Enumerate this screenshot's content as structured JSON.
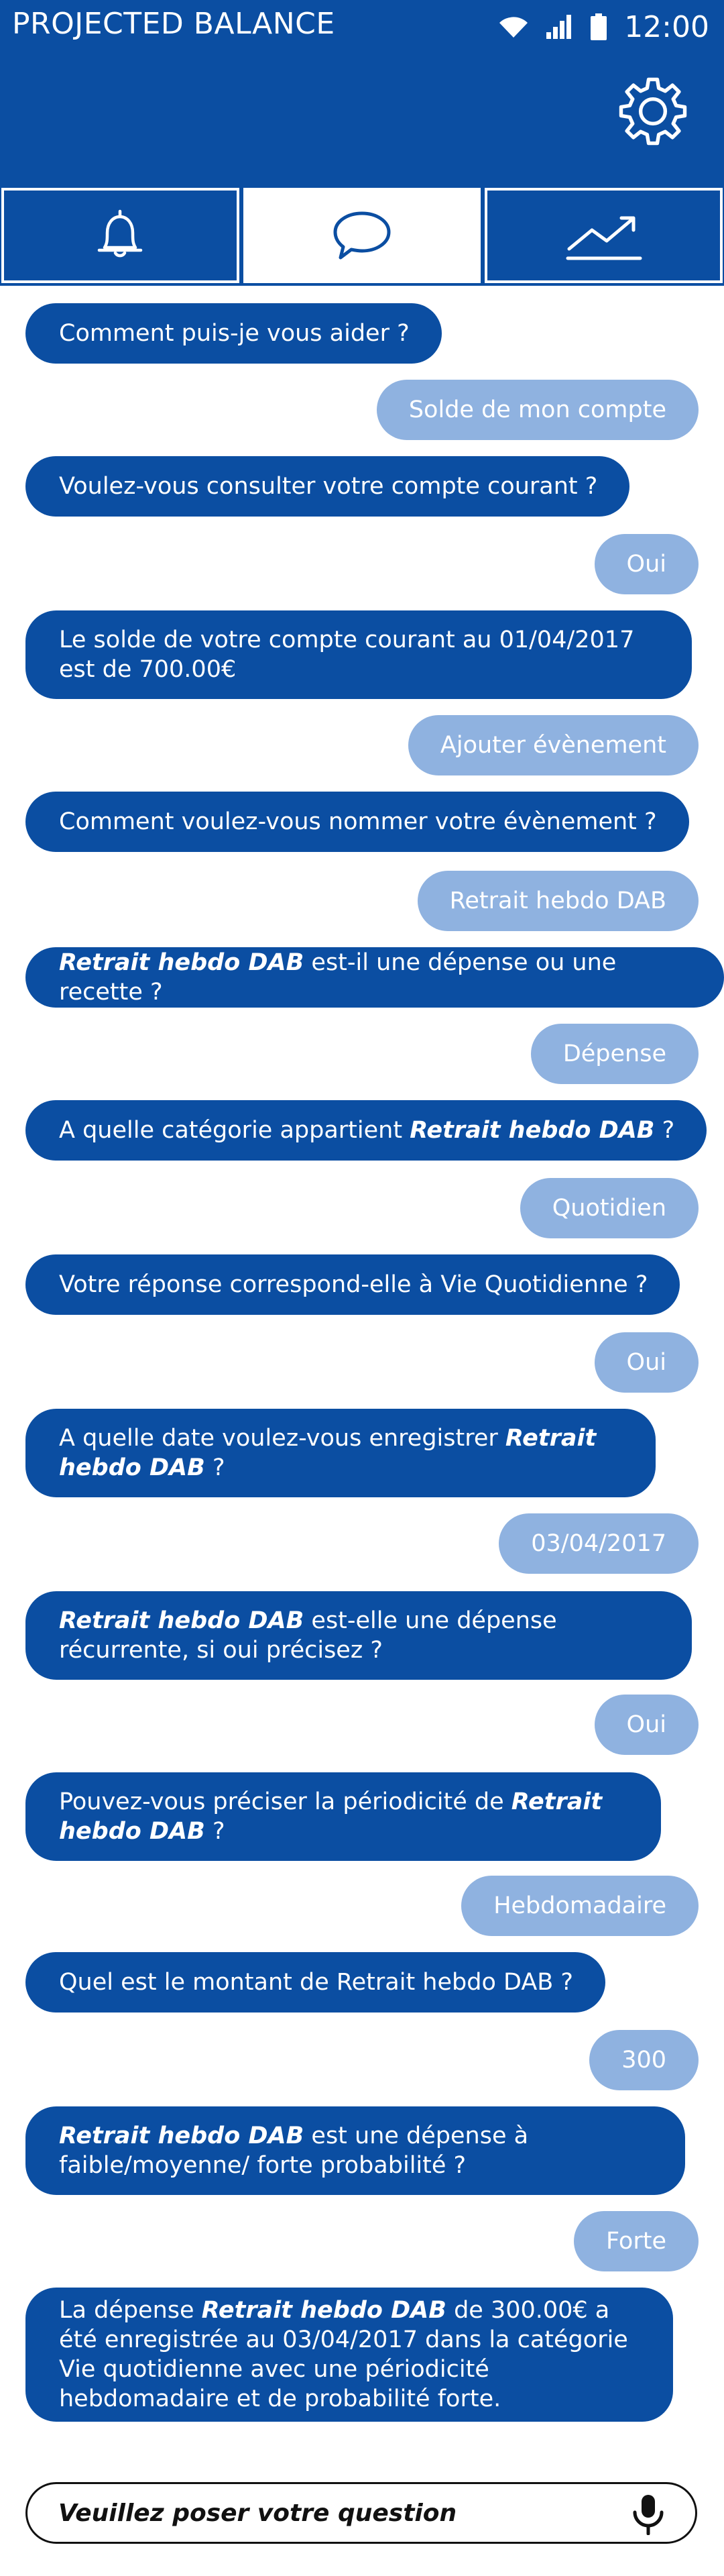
{
  "status_bar": {
    "app_title": "PROJECTED BALANCE",
    "time": "12:00",
    "icons": [
      "wifi-icon",
      "signal-icon",
      "battery-icon"
    ]
  },
  "header": {
    "settings_icon": "gear-icon"
  },
  "tabs": [
    {
      "name": "notifications",
      "icon": "bell-icon",
      "active": false
    },
    {
      "name": "chat",
      "icon": "chat-bubble-icon",
      "active": true
    },
    {
      "name": "forecast",
      "icon": "trend-up-icon",
      "active": false
    }
  ],
  "messages": [
    {
      "from": "bot",
      "text": "Comment puis-je vous aider ?"
    },
    {
      "from": "user",
      "text": "Solde de mon compte"
    },
    {
      "from": "bot",
      "text": "Voulez-vous consulter votre compte courant ?"
    },
    {
      "from": "user",
      "text": "Oui"
    },
    {
      "from": "bot",
      "text": "Le solde de votre compte courant au 01/04/2017 est de 700.00€"
    },
    {
      "from": "user",
      "text": "Ajouter évènement"
    },
    {
      "from": "bot",
      "text": "Comment voulez-vous nommer votre évènement ?"
    },
    {
      "from": "user",
      "text": "Retrait hebdo DAB"
    },
    {
      "from": "bot",
      "emph": "Retrait hebdo DAB",
      "text": " est-il une dépense ou une recette ?"
    },
    {
      "from": "user",
      "text": "Dépense"
    },
    {
      "from": "bot",
      "text": "A quelle catégorie appartient ",
      "emph": "Retrait hebdo DAB",
      "text_after": " ?"
    },
    {
      "from": "user",
      "text": "Quotidien"
    },
    {
      "from": "bot",
      "text": "Votre réponse correspond-elle à Vie Quotidienne ?"
    },
    {
      "from": "user",
      "text": "Oui"
    },
    {
      "from": "bot",
      "text": "A quelle date voulez-vous enregistrer ",
      "emph": "Retrait hebdo DAB",
      "text_after": " ?"
    },
    {
      "from": "user",
      "text": "03/04/2017"
    },
    {
      "from": "bot",
      "emph": "Retrait hebdo DAB",
      "text": " est-elle une dépense récurrente, si oui précisez ?"
    },
    {
      "from": "user",
      "text": "Oui"
    },
    {
      "from": "bot",
      "text": "Pouvez-vous préciser la périodicité de ",
      "emph": "Retrait hebdo DAB",
      "text_after": " ?"
    },
    {
      "from": "user",
      "text": "Hebdomadaire"
    },
    {
      "from": "bot",
      "text": "Quel est le montant de Retrait hebdo DAB ?"
    },
    {
      "from": "user",
      "text": "300"
    },
    {
      "from": "bot",
      "emph": "Retrait hebdo DAB",
      "text": " est une dépense à faible/moyenne/ forte probabilité ?"
    },
    {
      "from": "user",
      "text": "Forte"
    },
    {
      "from": "bot",
      "text": "La dépense ",
      "emph": "Retrait hebdo DAB",
      "text_after": " de 300.00€ a été enregistrée au 03/04/2017 dans la catégorie Vie quotidienne avec une périodicité hebdomadaire et de probabilité forte."
    }
  ],
  "composer": {
    "placeholder": "Veuillez poser votre question",
    "mic_icon": "microphone-icon"
  },
  "colors": {
    "primary": "#0b4ea2",
    "user_bubble": "#8fb2e0",
    "background": "#ffffff"
  }
}
